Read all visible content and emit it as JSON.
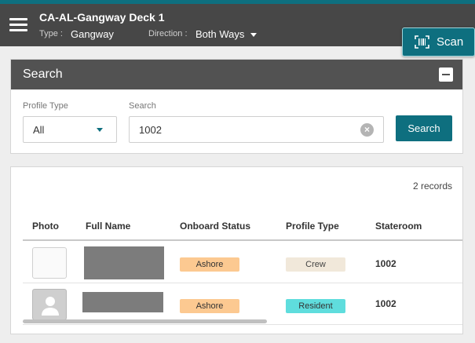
{
  "header": {
    "title": "CA-AL-Gangway Deck 1",
    "type_label": "Type :",
    "type_value": "Gangway",
    "direction_label": "Direction :",
    "direction_value": "Both Ways"
  },
  "scan_button": {
    "label": "Scan",
    "icon": "barcode-scan-icon"
  },
  "search": {
    "heading": "Search",
    "profile_type_label": "Profile Type",
    "profile_type_value": "All",
    "search_label": "Search",
    "search_value": "1002",
    "button_label": "Search"
  },
  "results": {
    "records": "2 records",
    "columns": [
      "Photo",
      "Full Name",
      "Onboard Status",
      "Profile Type",
      "Stateroom"
    ],
    "rows": [
      {
        "onboard_status": "Ashore",
        "profile_type": "Crew",
        "stateroom": "1002"
      },
      {
        "onboard_status": "Ashore",
        "profile_type": "Resident",
        "stateroom": "1002"
      }
    ]
  },
  "colors": {
    "accent": "#0e6f7f",
    "header_bg": "#474747",
    "ashore_badge": "#fcc991",
    "crew_badge": "#f1e8da",
    "resident_badge": "#5fdddd"
  }
}
